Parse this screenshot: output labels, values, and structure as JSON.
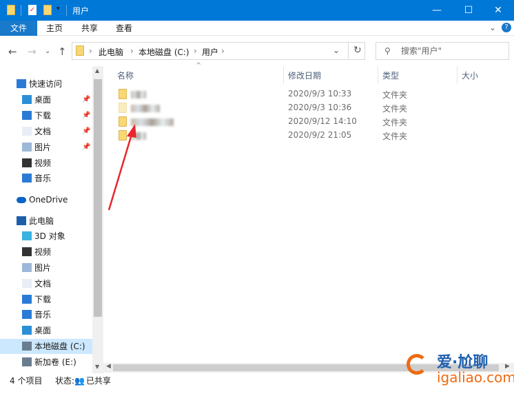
{
  "title_bar": {
    "title": "用户",
    "quick_access": [
      "folder-icon",
      "properties-icon",
      "new-folder-icon",
      "customize-dropdown-icon"
    ],
    "controls": [
      "minimize",
      "maximize",
      "close"
    ]
  },
  "ribbon": {
    "tabs": [
      "文件",
      "主页",
      "共享",
      "查看"
    ]
  },
  "nav": {
    "breadcrumb": [
      "此电脑",
      "本地磁盘 (C:)",
      "用户"
    ],
    "search_placeholder": "搜索\"用户\""
  },
  "sidebar": {
    "items": [
      {
        "label": "快速访问",
        "icon": "star-icon",
        "level": "top"
      },
      {
        "label": "桌面",
        "icon": "desktop-icon",
        "pinned": true
      },
      {
        "label": "下载",
        "icon": "download-icon",
        "pinned": true
      },
      {
        "label": "文档",
        "icon": "document-icon",
        "pinned": true
      },
      {
        "label": "图片",
        "icon": "picture-icon",
        "pinned": true
      },
      {
        "label": "视频",
        "icon": "video-icon"
      },
      {
        "label": "音乐",
        "icon": "music-icon"
      },
      {
        "label": "OneDrive",
        "icon": "cloud-icon",
        "level": "top"
      },
      {
        "label": "此电脑",
        "icon": "computer-icon",
        "level": "top"
      },
      {
        "label": "3D 对象",
        "icon": "cube-icon"
      },
      {
        "label": "视频",
        "icon": "video-icon"
      },
      {
        "label": "图片",
        "icon": "picture-icon"
      },
      {
        "label": "文档",
        "icon": "document-icon"
      },
      {
        "label": "下载",
        "icon": "download-icon"
      },
      {
        "label": "音乐",
        "icon": "music-icon"
      },
      {
        "label": "桌面",
        "icon": "desktop-icon"
      },
      {
        "label": "本地磁盘 (C:)",
        "icon": "drive-icon",
        "selected": true
      },
      {
        "label": "新加卷 (E:)",
        "icon": "drive-icon"
      }
    ]
  },
  "columns": [
    "名称",
    "修改日期",
    "类型",
    "大小"
  ],
  "files": [
    {
      "date": "2020/9/3 10:33",
      "type": "文件夹"
    },
    {
      "date": "2020/9/3 10:36",
      "type": "文件夹"
    },
    {
      "date": "2020/9/12 14:10",
      "type": "文件夹"
    },
    {
      "date": "2020/9/2 21:05",
      "type": "文件夹"
    }
  ],
  "status": {
    "count": "4 个项目",
    "state_label": "状态:",
    "state": "已共享"
  },
  "watermark": {
    "text": "爱·尬聊",
    "url": "igaliao.com"
  },
  "colors": {
    "accent": "#0078d7",
    "selected": "#cce8ff",
    "annotation_arrow": "#e8262b"
  }
}
